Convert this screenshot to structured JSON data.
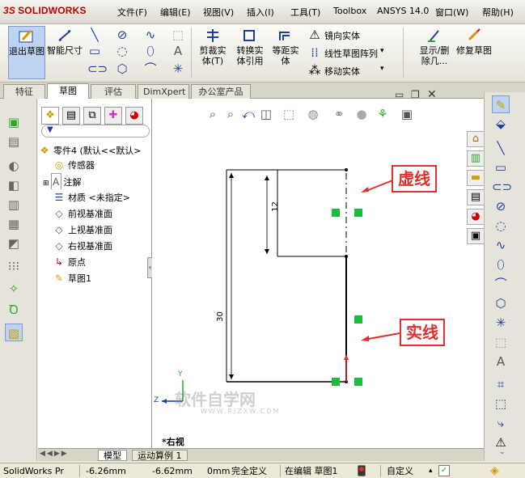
{
  "app": {
    "logo_prefix": "3S",
    "logo_text": "SOLIDWORKS"
  },
  "menu": [
    {
      "label": "文件(F)"
    },
    {
      "label": "编辑(E)"
    },
    {
      "label": "视图(V)"
    },
    {
      "label": "插入(I)"
    },
    {
      "label": "工具(T)"
    },
    {
      "label": "Toolbox"
    },
    {
      "label": "ANSYS 14.0"
    },
    {
      "label": "窗口(W)"
    },
    {
      "label": "帮助(H)"
    }
  ],
  "ribbon": {
    "exit_sketch": "退出草图",
    "smart_dim": "智能尺寸",
    "trim": "剪裁实体(T)",
    "convert": "转换实体引用",
    "offset": "等距实体",
    "mirror": "镜向实体",
    "linear_pattern": "线性草图阵列",
    "move": "移动实体",
    "show_delete": "显示/删除几...",
    "repair": "修复草图"
  },
  "tabs": [
    {
      "label": "特征"
    },
    {
      "label": "草图"
    },
    {
      "label": "评估"
    },
    {
      "label": "DimXpert"
    },
    {
      "label": "办公室产品"
    }
  ],
  "tree": {
    "root": "零件4  (默认<<默认>",
    "items": [
      {
        "label": "传感器"
      },
      {
        "label": "注解"
      },
      {
        "label": "材质 <未指定>"
      },
      {
        "label": "前视基准面"
      },
      {
        "label": "上视基准面"
      },
      {
        "label": "右视基准面"
      },
      {
        "label": "原点"
      },
      {
        "label": "草图1"
      }
    ]
  },
  "canvas": {
    "dim_vertical_small": "12",
    "dim_vertical_large": "30",
    "view_label": "*右视",
    "callout_dashed": "虚线",
    "callout_solid": "实线",
    "watermark": "软件自学网",
    "watermark_url": "WWW.RJZXW.COM",
    "axis_y": "Y",
    "axis_z": "Z"
  },
  "bottom_tabs": [
    {
      "label": "模型"
    },
    {
      "label": "运动算例 1"
    }
  ],
  "status": {
    "app": "SolidWorks Pr",
    "x": "-6.26mm",
    "y": "-6.62mm",
    "z": "0mm",
    "state": "完全定义",
    "editing": "在编辑 草图1",
    "custom": "自定义"
  },
  "colors": {
    "accent": "#1d3f9e",
    "callout": "#e0302e",
    "constraint_green": "#1dbb3c"
  }
}
